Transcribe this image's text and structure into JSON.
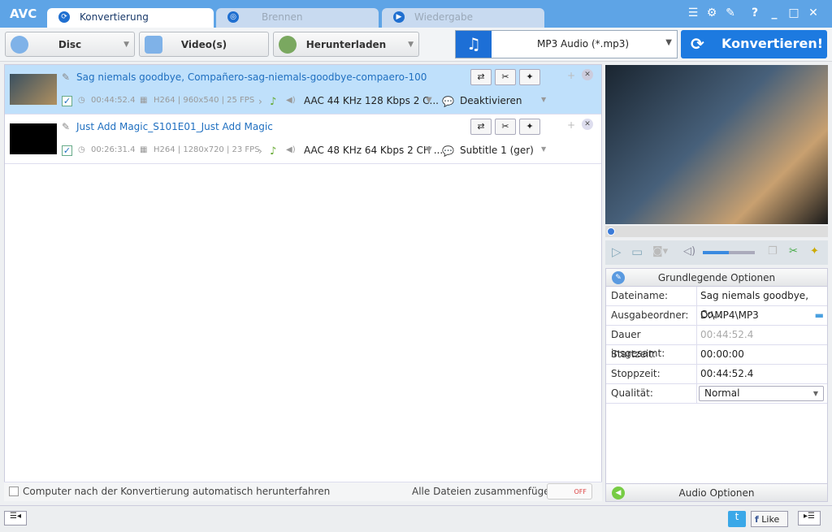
{
  "app": {
    "logo": "AVC"
  },
  "tabs": [
    {
      "label": "Konvertierung"
    },
    {
      "label": "Brennen"
    },
    {
      "label": "Wiedergabe"
    }
  ],
  "window_buttons": [
    "list-icon",
    "gear-icon",
    "wrench-icon",
    "help-icon",
    "minimize-icon",
    "maximize-icon",
    "close-icon"
  ],
  "window_glyphs": [
    "☰",
    "⚙",
    "✎",
    "?",
    "_",
    "□",
    "✕"
  ],
  "toolbar": {
    "disc": "Disc",
    "video": "Video(s)",
    "download": "Herunterladen",
    "format": "MP3 Audio (*.mp3)",
    "convert": "Konvertieren!"
  },
  "files": [
    {
      "title": "Sag niemals goodbye, Compañero-sag-niemals-goodbye-compaero-100",
      "duration": "00:44:52.4",
      "video": "H264 | 960x540 | 25 FPS",
      "audio": "AAC 44 KHz 128 Kbps 2 C...",
      "subtitle": "Deaktivieren",
      "selected": true
    },
    {
      "title": "Just Add Magic_S101E01_Just Add Magic",
      "duration": "00:26:31.4",
      "video": "H264 | 1280x720 | 23 FPS",
      "audio": "AAC 48 KHz 64 Kbps 2 CH ...",
      "subtitle": "Subtitle 1 (ger)",
      "selected": false
    }
  ],
  "footer": {
    "shutdown": "Computer nach der Konvertierung automatisch herunterfahren",
    "merge": "Alle Dateien zusammenfügen",
    "toggle": "OFF"
  },
  "player": {
    "progress": 0,
    "volume": 0.5
  },
  "options": {
    "header": "Grundlegende Optionen",
    "rows": [
      {
        "k": "Dateiname:",
        "v": "Sag niemals goodbye, Co..."
      },
      {
        "k": "Ausgabeordner:",
        "v": "D:\\MP4\\MP3"
      },
      {
        "k": "Dauer insgesamt:",
        "v": "00:44:52.4"
      },
      {
        "k": "Startzeit:",
        "v": "00:00:00"
      },
      {
        "k": "Stoppzeit:",
        "v": "00:44:52.4"
      },
      {
        "k": "Qualität:",
        "v": "Normal"
      }
    ],
    "audio_header": "Audio Optionen"
  },
  "status": {
    "like": "Like"
  }
}
